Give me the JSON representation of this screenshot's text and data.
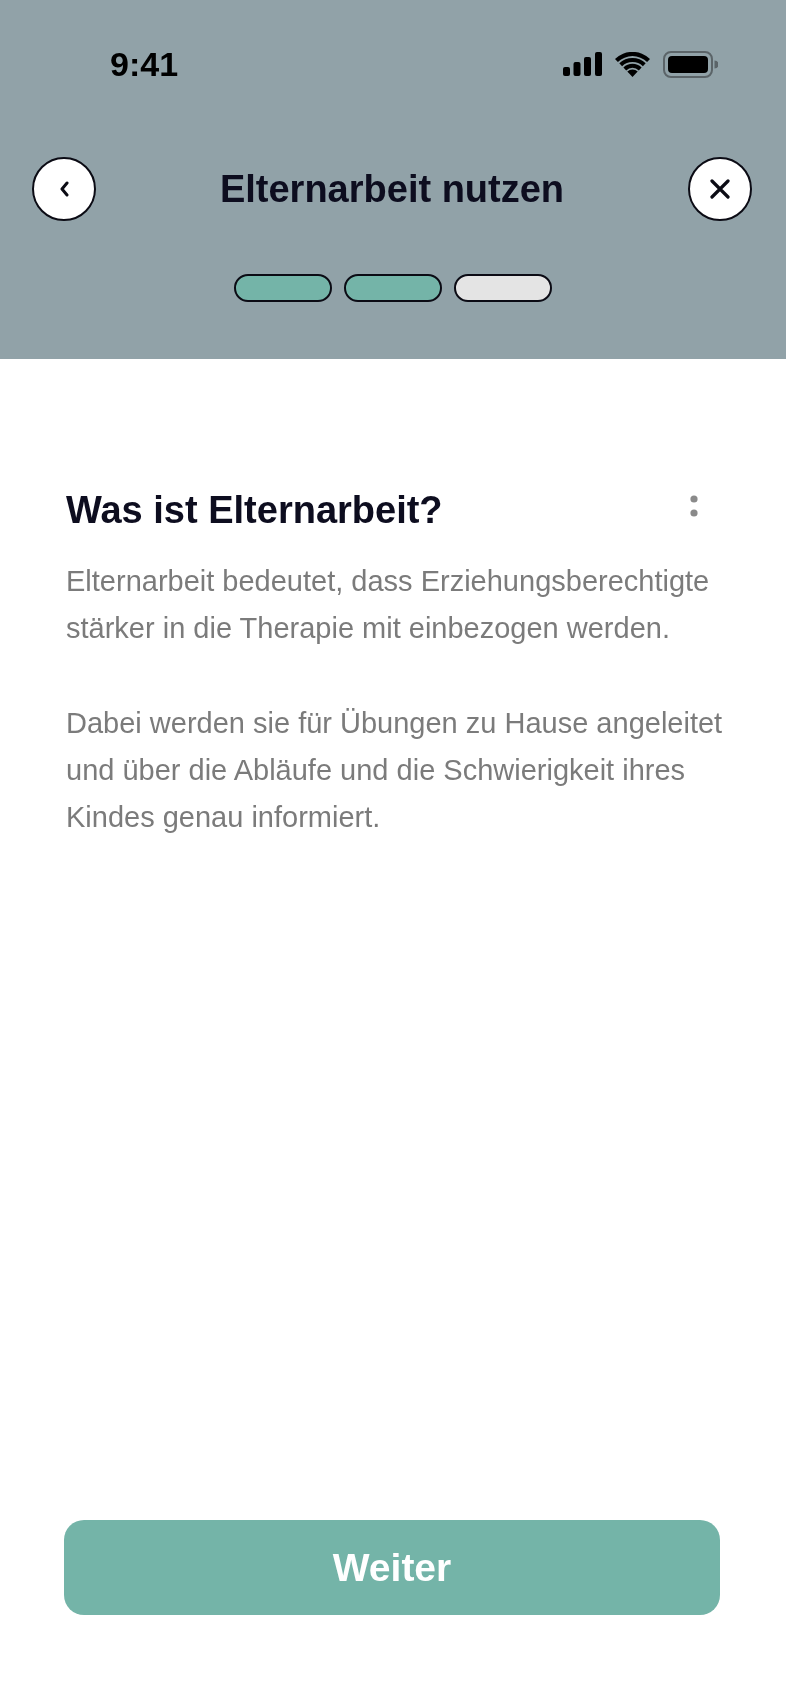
{
  "status_bar": {
    "time": "9:41"
  },
  "header": {
    "title": "Elternarbeit nutzen",
    "progress_steps": [
      {
        "done": true
      },
      {
        "done": true
      },
      {
        "done": false
      }
    ]
  },
  "content": {
    "heading": "Was ist Elternarbeit?",
    "paragraphs": [
      "Elternarbeit bedeutet, dass Erziehungsberechtigte stärker in die Therapie mit einbezogen werden.",
      "Dabei werden sie für Übungen zu Hause angeleitet und über die Abläufe und die Schwierigkeit ihres Kindes genau informiert."
    ]
  },
  "primary_button": {
    "label": "Weiter"
  }
}
